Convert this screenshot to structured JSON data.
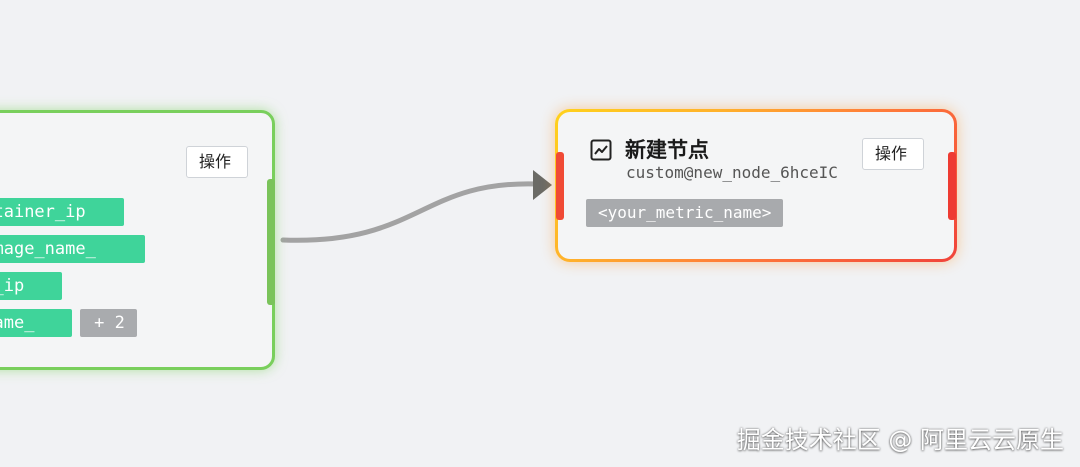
{
  "left_node": {
    "action_label": "操作",
    "tags": [
      "ntainer_ip_",
      "_image_name_",
      "e_ip_",
      "_name_"
    ],
    "more_tag": "+ 2",
    "color": "#79cf5c"
  },
  "right_node": {
    "icon": "line-chart-icon",
    "title": "新建节点",
    "subtitle": "custom@new_node_6hceIC",
    "action_label": "操作",
    "metric_tag": "<your_metric_name>",
    "gradient_colors": [
      "#ffd21c",
      "#ff7a3a",
      "#f0433a"
    ]
  },
  "edge": {
    "color": "#a3a3a3",
    "arrow_color": "#6b6b66"
  },
  "watermark": "掘金技术社区 @ 阿里云云原生"
}
